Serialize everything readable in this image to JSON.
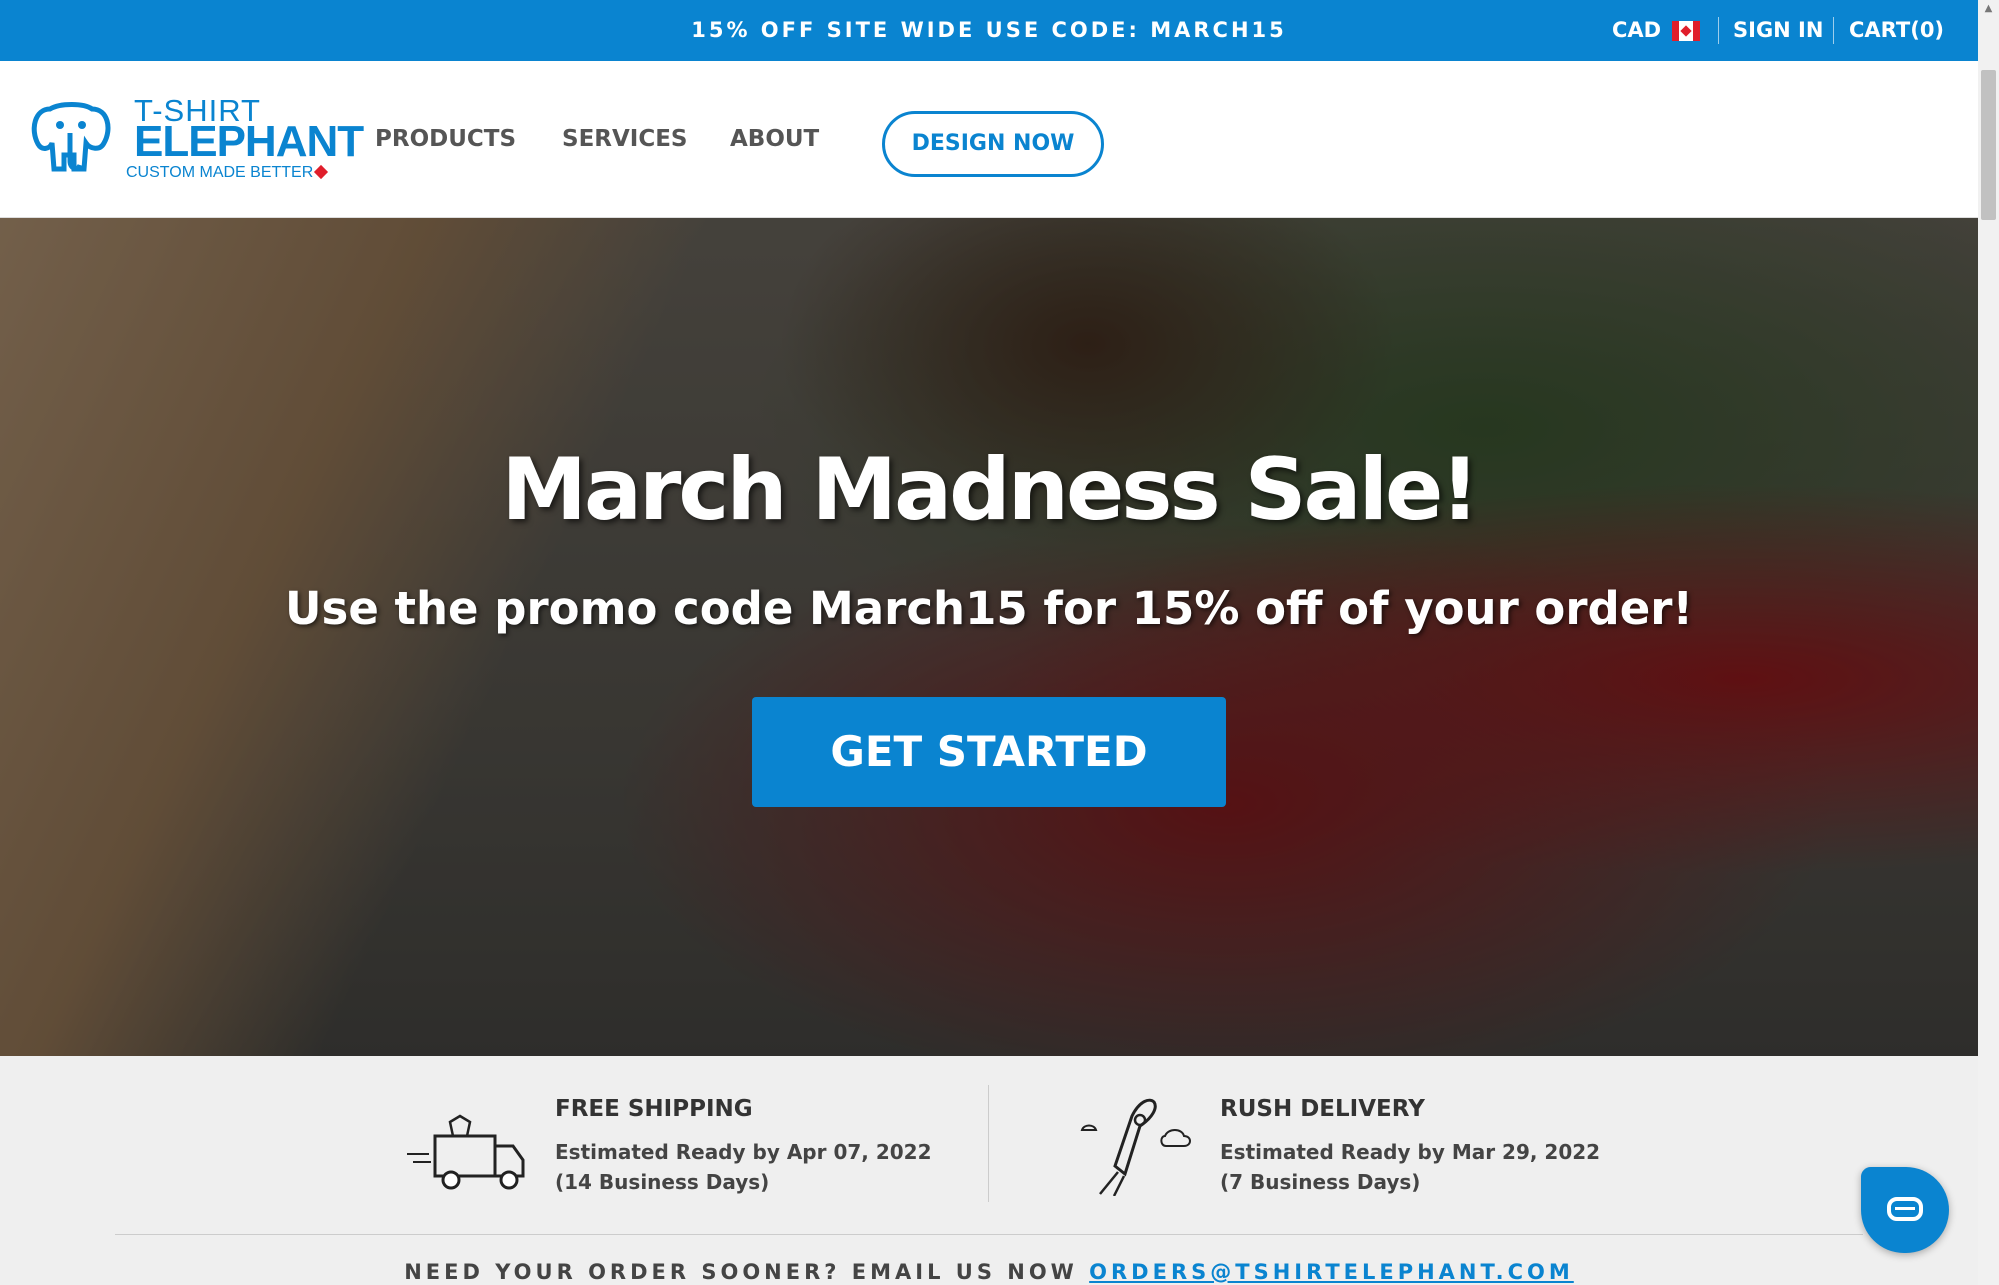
{
  "promo": {
    "text": "15% OFF SITE WIDE USE CODE: MARCH15",
    "currency": "CAD",
    "sign_in": "SIGN IN",
    "cart": "CART(0)"
  },
  "header": {
    "logo": {
      "line1": "T-SHIRT",
      "line2": "ELEPHANT",
      "tagline": "CUSTOM MADE BETTER"
    },
    "nav": [
      "PRODUCTS",
      "SERVICES",
      "ABOUT"
    ],
    "cta": "DESIGN NOW"
  },
  "hero": {
    "title": "March Madness Sale!",
    "subtitle": "Use the promo code March15 for 15% off of your order!",
    "button": "GET STARTED"
  },
  "delivery": {
    "free": {
      "title": "FREE SHIPPING",
      "line1": "Estimated Ready by Apr 07, 2022",
      "line2": "(14 Business Days)",
      "icon": "delivery-truck-icon"
    },
    "rush": {
      "title": "RUSH DELIVERY",
      "line1": "Estimated Ready by Mar 29, 2022",
      "line2": "(7 Business Days)",
      "icon": "rocket-icon"
    }
  },
  "sooner": {
    "text": "NEED YOUR ORDER SOONER? EMAIL US NOW",
    "email": "ORDERS@TSHIRTELEPHANT.COM"
  },
  "colors": {
    "brand": "#0a84d0",
    "accent_red": "#e01e2b"
  }
}
